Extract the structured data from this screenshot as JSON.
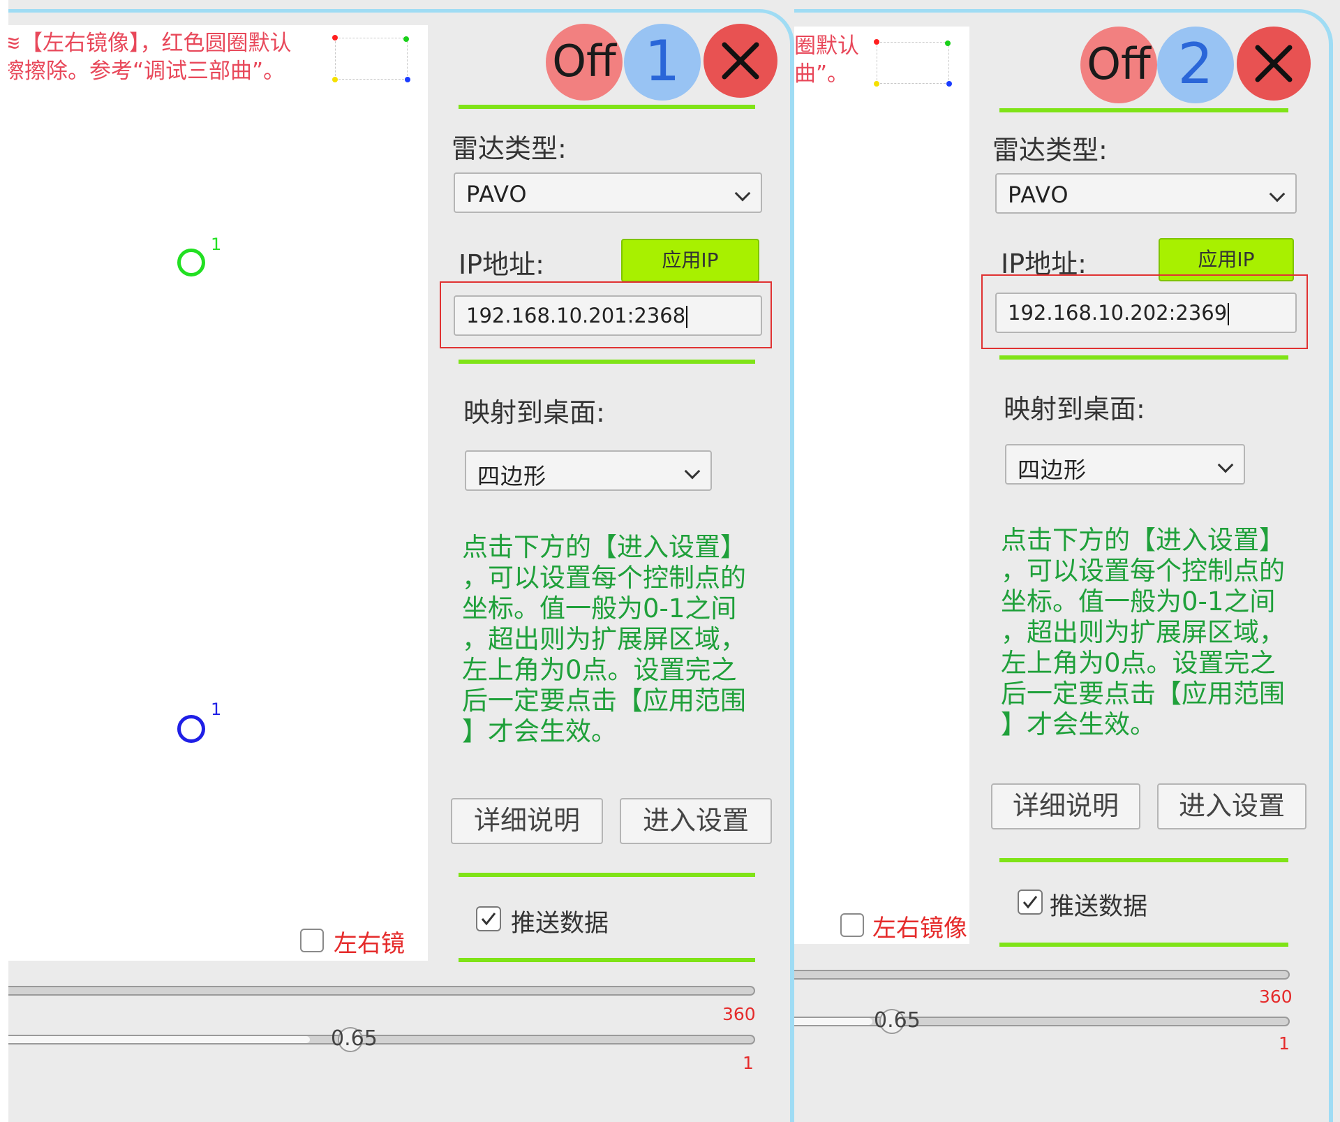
{
  "panels": [
    {
      "note_lines": [
        "≋【左右镜像】，红色圆圈默认",
        "擦擦除。参考“调试三部曲”。"
      ],
      "point1_label": "1",
      "point2_label": "1",
      "mirror_label": "左右镜像",
      "mirror_checked": false,
      "off_label": "Off",
      "number_label": "1",
      "radar_type_label": "雷达类型:",
      "radar_type_value": "PAVO",
      "ip_label": "IP地址:",
      "apply_ip_label": "应用IP",
      "ip_value": "192.168.10.201:2368",
      "map_label": "映射到桌面:",
      "map_value": "四边形",
      "help_lines": [
        "点击下方的【进入设置】",
        "，可以设置每个控制点的",
        "坐标。值一般为0-1之间",
        "，超出则为扩展屏区域，",
        "左上角为0点。设置完之",
        "后一定要点击【应用范围",
        "】才会生效。"
      ],
      "details_button": "详细说明",
      "settings_button": "进入设置",
      "push_label": "推送数据",
      "push_checked": true,
      "rotation_max_label": "360",
      "scale_value_label": "0.65",
      "scale_max_label": "1"
    },
    {
      "note_lines": [
        "圈默认",
        "曲”。"
      ],
      "mirror_label": "左右镜像",
      "mirror_checked": false,
      "off_label": "Off",
      "number_label": "2",
      "radar_type_label": "雷达类型:",
      "radar_type_value": "PAVO",
      "ip_label": "IP地址:",
      "apply_ip_label": "应用IP",
      "ip_value": "192.168.10.202:2369",
      "map_label": "映射到桌面:",
      "map_value": "四边形",
      "help_lines": [
        "点击下方的【进入设置】",
        "，可以设置每个控制点的",
        "坐标。值一般为0-1之间",
        "，超出则为扩展屏区域，",
        "左上角为0点。设置完之",
        "后一定要点击【应用范围",
        "】才会生效。"
      ],
      "details_button": "详细说明",
      "settings_button": "进入设置",
      "push_label": "推送数据",
      "push_checked": true,
      "rotation_max_label": "360",
      "scale_value_label": "0.65",
      "scale_max_label": "1"
    }
  ],
  "colors": {
    "corner_top_left": "#ff1f1f",
    "corner_top_right": "#19d019",
    "corner_bottom_left": "#f5e000",
    "corner_bottom_right": "#1a3cff",
    "point1": "#22e022",
    "point2": "#1f1fe6",
    "accent_line": "#7fe317",
    "help_text": "#1fa03a"
  },
  "icons": {
    "close_button": "close-x-icon",
    "dropdown": "chevron-down-icon",
    "checkbox_checked": "check-icon"
  }
}
